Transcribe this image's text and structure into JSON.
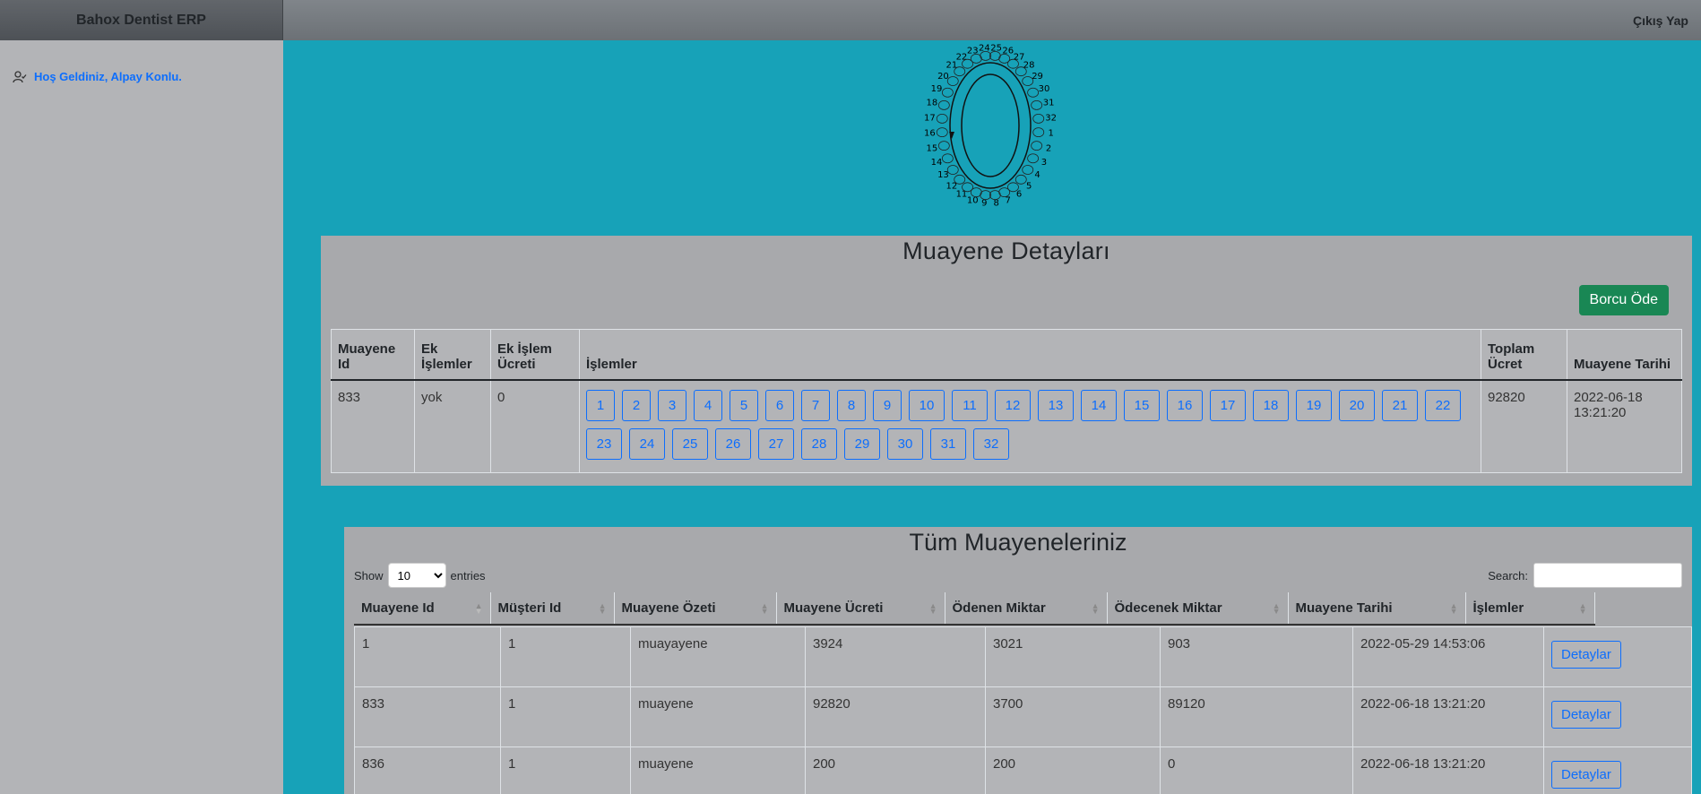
{
  "header": {
    "brand": "Bahox Dentist ERP",
    "logout_label": "Çıkış Yap"
  },
  "sidebar": {
    "welcome_text": "Hoş Geldiniz, Alpay Konlu.",
    "welcome_icon": "user-check-icon"
  },
  "tooth_chart": {
    "numbers": [
      "1",
      "2",
      "3",
      "4",
      "5",
      "6",
      "7",
      "8",
      "9",
      "10",
      "11",
      "12",
      "13",
      "14",
      "15",
      "16",
      "17",
      "18",
      "19",
      "20",
      "21",
      "22",
      "23",
      "24",
      "25",
      "26",
      "27",
      "28",
      "29",
      "30",
      "31",
      "32"
    ]
  },
  "detail": {
    "title": "Muayene Detayları",
    "pay_button": "Borcu Öde",
    "columns": [
      "Muayene Id",
      "Ek İşlemler",
      "Ek İşlem Ücreti",
      "İşlemler",
      "Toplam Ücret",
      "Muayene Tarihi"
    ],
    "row": {
      "id": "833",
      "extra": "yok",
      "extra_fee": "0",
      "teeth": [
        "1",
        "2",
        "3",
        "4",
        "5",
        "6",
        "7",
        "8",
        "9",
        "10",
        "11",
        "12",
        "13",
        "14",
        "15",
        "16",
        "17",
        "18",
        "19",
        "20",
        "21",
        "22",
        "23",
        "24",
        "25",
        "26",
        "27",
        "28",
        "29",
        "30",
        "31",
        "32"
      ],
      "total": "92820",
      "date": "2022-06-18 13:21:20"
    }
  },
  "list": {
    "title": "Tüm Muayeneleriniz",
    "show_label": "Show",
    "entries_label": "entries",
    "page_size": "10",
    "search_label": "Search:",
    "columns": [
      "Muayene Id",
      "Müşteri Id",
      "Muayene Özeti",
      "Muayene Ücreti",
      "Ödenen Miktar",
      "Ödecenek Miktar",
      "Muayene Tarihi",
      "İşlemler"
    ],
    "rows": [
      [
        "1",
        "1",
        "muayayene",
        "3924",
        "3021",
        "903",
        "2022-05-29 14:53:06",
        "Detaylar"
      ],
      [
        "833",
        "1",
        "muayene",
        "92820",
        "3700",
        "89120",
        "2022-06-18 13:21:20",
        "Detaylar"
      ],
      [
        "836",
        "1",
        "muayene",
        "200",
        "200",
        "0",
        "2022-06-18 13:21:20",
        "Detaylar"
      ]
    ]
  }
}
